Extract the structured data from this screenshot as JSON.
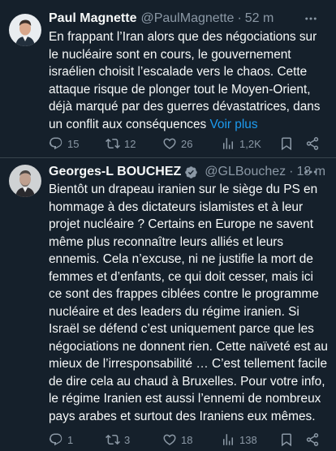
{
  "tweets": [
    {
      "author_name": "Paul Magnette",
      "handle": "@PaulMagnette",
      "separator": "·",
      "time": "52 m",
      "text": "En frappant l’Iran alors que des négociations sur le nucléaire sont en cours, le gouvernement israélien choisit l’escalade vers le chaos. Cette attaque risque de plonger tout le Moyen-Orient, déjà marqué par des guerres dévastatrices, dans un conflit aux conséquences",
      "show_more": "Voir plus",
      "replies": "15",
      "reposts": "12",
      "likes": "26",
      "views": "1,2K",
      "verified": false
    },
    {
      "author_name": "Georges-L BOUCHEZ",
      "handle": "@GLBouchez",
      "separator": "·",
      "time": "18 m",
      "text": "Bientôt un drapeau iranien sur le siège du PS en hommage à des dictateurs islamistes et à leur projet nucléaire ? Certains en Europe ne savent même plus reconnaître leurs alliés et leurs ennemis. Cela n’excuse, ni ne justifie la mort de femmes et d’enfants, ce qui doit cesser, mais ici ce sont des frappes ciblées contre le programme nucléaire et des leaders du régime iranien. Si Israël se défend c’est uniquement parce que les négociations ne donnent rien. Cette naïveté est au mieux de l’irresponsabilité … C’est tellement facile de dire cela au chaud à Bruxelles. Pour votre info, le régime Iranien est aussi l’ennemi de nombreux pays arabes et surtout des Iraniens eux mêmes.",
      "show_more": "",
      "replies": "1",
      "reposts": "3",
      "likes": "18",
      "views": "138",
      "verified": true
    }
  ],
  "colors": {
    "background": "#15202b",
    "text": "#f7f9f9",
    "secondary": "#8b98a5",
    "link": "#1d9bf0",
    "divider": "#38444d",
    "verified_badge": "#8b98a5"
  },
  "icons": [
    "reply-icon",
    "repost-icon",
    "like-icon",
    "views-icon",
    "bookmark-icon",
    "share-icon",
    "verified-badge-icon",
    "more-icon"
  ]
}
